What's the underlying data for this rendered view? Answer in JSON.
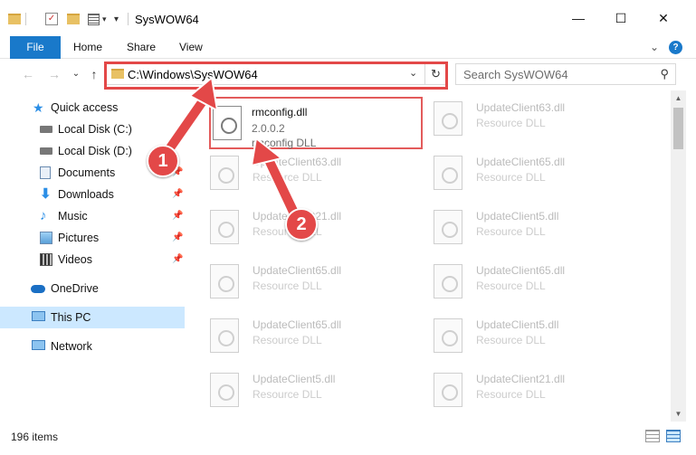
{
  "window": {
    "title": "SysWOW64",
    "minimize": "—",
    "maximize": "☐",
    "close": "✕"
  },
  "ribbon": {
    "tabs": [
      "File",
      "Home",
      "Share",
      "View"
    ],
    "expand": "⌄",
    "help": "?"
  },
  "nav": {
    "back": "←",
    "forward": "→",
    "recent": "⌄",
    "up": "↑"
  },
  "address": {
    "path": "C:\\Windows\\SysWOW64",
    "chevron": "⌄",
    "refresh": "↻"
  },
  "search": {
    "placeholder": "Search SysWOW64",
    "icon": "⚲"
  },
  "sidebar": {
    "items": [
      {
        "label": "Quick access",
        "icon": "star-icon"
      },
      {
        "label": "Local Disk (C:)",
        "icon": "drive-icon",
        "pinned": true
      },
      {
        "label": "Local Disk (D:)",
        "icon": "drive-icon",
        "pinned": true
      },
      {
        "label": "Documents",
        "icon": "documents-icon",
        "pinned": true
      },
      {
        "label": "Downloads",
        "icon": "download-icon",
        "pinned": true
      },
      {
        "label": "Music",
        "icon": "music-icon",
        "pinned": true
      },
      {
        "label": "Pictures",
        "icon": "pictures-icon",
        "pinned": true
      },
      {
        "label": "Videos",
        "icon": "videos-icon",
        "pinned": true
      },
      {
        "label": "OneDrive",
        "icon": "cloud-icon"
      },
      {
        "label": "This PC",
        "icon": "computer-icon",
        "selected": true
      },
      {
        "label": "Network",
        "icon": "network-icon"
      }
    ],
    "pin_glyph": "📌"
  },
  "files": {
    "selected": {
      "name": "rmconfig.dll",
      "version": "2.0.0.2",
      "description": "rmconfig DLL"
    },
    "left_column": [
      {
        "name": "UpdateClient63.dll",
        "description": "Resource DLL"
      },
      {
        "name": "UpdateClient21.dll",
        "description": "Resource DLL"
      },
      {
        "name": "UpdateClient65.dll",
        "description": "Resource DLL"
      },
      {
        "name": "UpdateClient65.dll",
        "description": "Resource DLL"
      },
      {
        "name": "UpdateClient5.dll",
        "description": "Resource DLL"
      }
    ],
    "right_column": [
      {
        "name": "UpdateClient63.dll",
        "description": "Resource DLL"
      },
      {
        "name": "UpdateClient65.dll",
        "description": "Resource DLL"
      },
      {
        "name": "UpdateClient5.dll",
        "description": "Resource DLL"
      },
      {
        "name": "UpdateClient65.dll",
        "description": "Resource DLL"
      },
      {
        "name": "UpdateClient5.dll",
        "description": "Resource DLL"
      },
      {
        "name": "UpdateClient21.dll",
        "description": "Resource DLL"
      }
    ]
  },
  "status": {
    "item_count": "196 items"
  },
  "annotations": {
    "step1": "1",
    "step2": "2",
    "color": "#e34848"
  }
}
